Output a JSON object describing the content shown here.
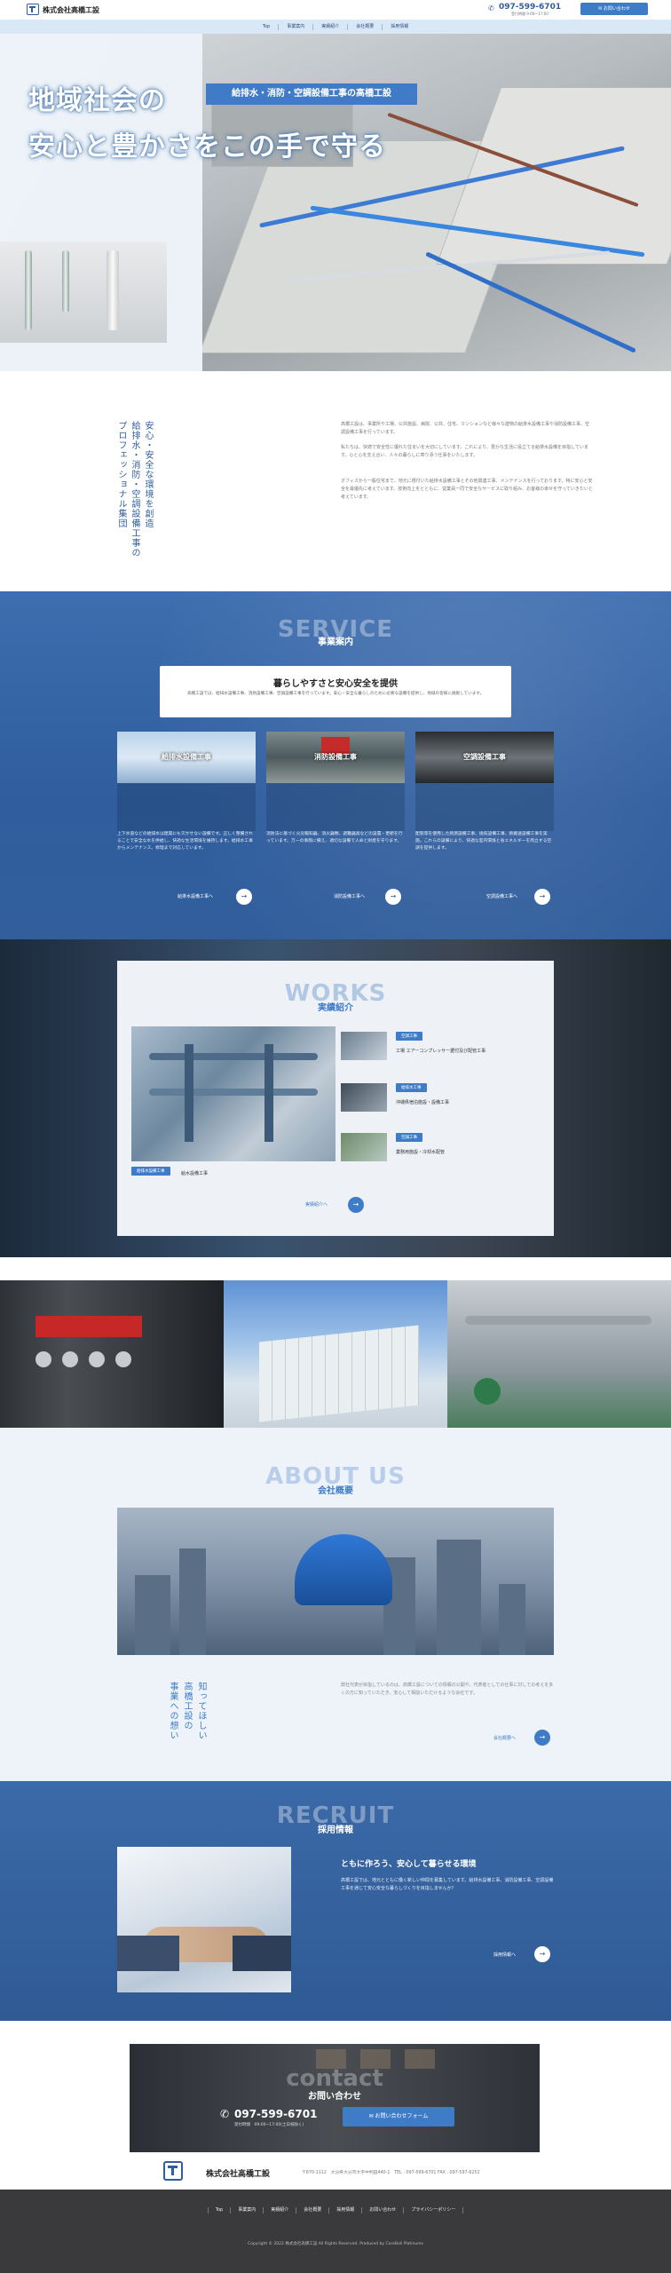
{
  "header": {
    "company": "株式会社高橋工設",
    "phone": "097-599-6701",
    "hours": "受付時間 9:00〜17:00",
    "contact_button": "お問い合わせ"
  },
  "nav": [
    "Top",
    "事業案内",
    "実績紹介",
    "会社概要",
    "採用情報"
  ],
  "hero": {
    "line1": "地域社会の",
    "line2": "安心と豊かさをこの手で守る",
    "badge": "給排水・消防・空調設備工事の高橋工設"
  },
  "intro": {
    "vertical": [
      "安心・安全な環境を創造",
      "給排水・消防・空調設備工事の",
      "プロフェッショナル集団"
    ],
    "paragraphs": [
      "高橋工設は、事業所や工場、公共施設、病院、公共、住宅、マンションなど様々な建物の給排水設備工事や消防設備工事、空調設備工事を行っています。",
      "私たちは、快適で安全性に優れた住まいを大切にしています。これにより、豊かな生活に役立てる給排水設備を目指しています。心と心を支え合い、人々の暮らしに寄り添う仕事をいたします。",
      "オフィスから一般住宅まで、地元に根付いた給排水設備工事とその他関連工事、メンテナンスを行っております。特に安心と安全を最優先に考えています。技術向上をとともに、従業員一同で安全なサービスに取り組み、お客様の幸せを守っていきたいと考えています。"
    ]
  },
  "service": {
    "en": "SERVICE",
    "ja": "事業案内",
    "card_title": "暮らしやすさと安心安全を提供",
    "card_text": "高橋工設では、給排水設備工事、消防設備工事、空調設備工事を行っています。安心・安全な暮らしのために必要な設備を提供し、地域の皆様に貢献しています。",
    "items": [
      {
        "label": "給排水設備工事",
        "desc": "上下水道などの給排水は建築にも欠かせない設備です。正しく整備されることで安全な水を供給し、快適な生活環境を維持します。給排水工事からメンテナンス、修理まで対応しています。",
        "link": "給排水設備工事へ"
      },
      {
        "label": "消防設備工事",
        "desc": "消防法に基づく火災報知器、消火器類、避難器具などの設置・更新を行っています。万一の事態に備え、適切な設備で人命と財産を守ります。",
        "link": "消防設備工事へ"
      },
      {
        "label": "空調設備工事",
        "desc": "配管等を使用した熱源設備工事、換気設備工事、熱搬送設備工事を実施。これらの設備により、快適な室内環境と省エネルギーを両立する空調を提供します。",
        "link": "空調設備工事へ"
      }
    ]
  },
  "works": {
    "en": "WORKS",
    "ja": "実績紹介",
    "main_tag": "給排水設備工事",
    "main_title": "給水設備工事",
    "list": [
      {
        "tag": "空調工事",
        "title": "工場 エアーコンプレッサー据付及び配管工事"
      },
      {
        "tag": "給排水工事",
        "title": "沖縄県宿泊施設・設備工事"
      },
      {
        "tag": "空調工事",
        "title": "業務用施設・冷却水配管"
      }
    ],
    "more": "実績紹介へ"
  },
  "about": {
    "en": "ABOUT US",
    "ja": "会社概要",
    "vertical": [
      "知ってほしい",
      "高橋工設の",
      "事業への想い"
    ],
    "text": "弊社代表が目指しているのは、高橋工設についての情報の公開や、代表者としての仕事に対しての考えを多くの方に知っていただき、安心して相談いただけるような会社です。",
    "more": "会社概要へ"
  },
  "recruit": {
    "en": "RECRUIT",
    "ja": "採用情報",
    "heading": "ともに作ろう、安心して暮らせる環境",
    "text": "高橋工設では、地元とともに働く新しい仲間を募集しています。給排水設備工事、消防設備工事、空調設備工事を通じて安心安全な暮らしづくりを目指しませんか？",
    "more": "採用情報へ"
  },
  "contact": {
    "en": "contact",
    "ja": "お問い合わせ",
    "phone": "097-599-6701",
    "hours": "受付時間　09:00~17:00(土日祝除く)",
    "form_button": "お問い合わせフォーム"
  },
  "footer": {
    "company": "株式会社高橋工設",
    "address": "〒870-1112　大分県大分市大字中判田440-1　TEL : 097-599-6701  FAX : 097-597-6252",
    "nav": [
      "Top",
      "事業案内",
      "実績紹介",
      "会社概要",
      "採用情報",
      "お問い合わせ",
      "プライバシーポリシー"
    ],
    "copyright": "Copyright © 2022 株式会社高橋工設 All Rights Reserved. Produced by CoreBall Platinums"
  },
  "colors": {
    "accent": "#3e7cc7",
    "brand": "#2f5d9e"
  }
}
